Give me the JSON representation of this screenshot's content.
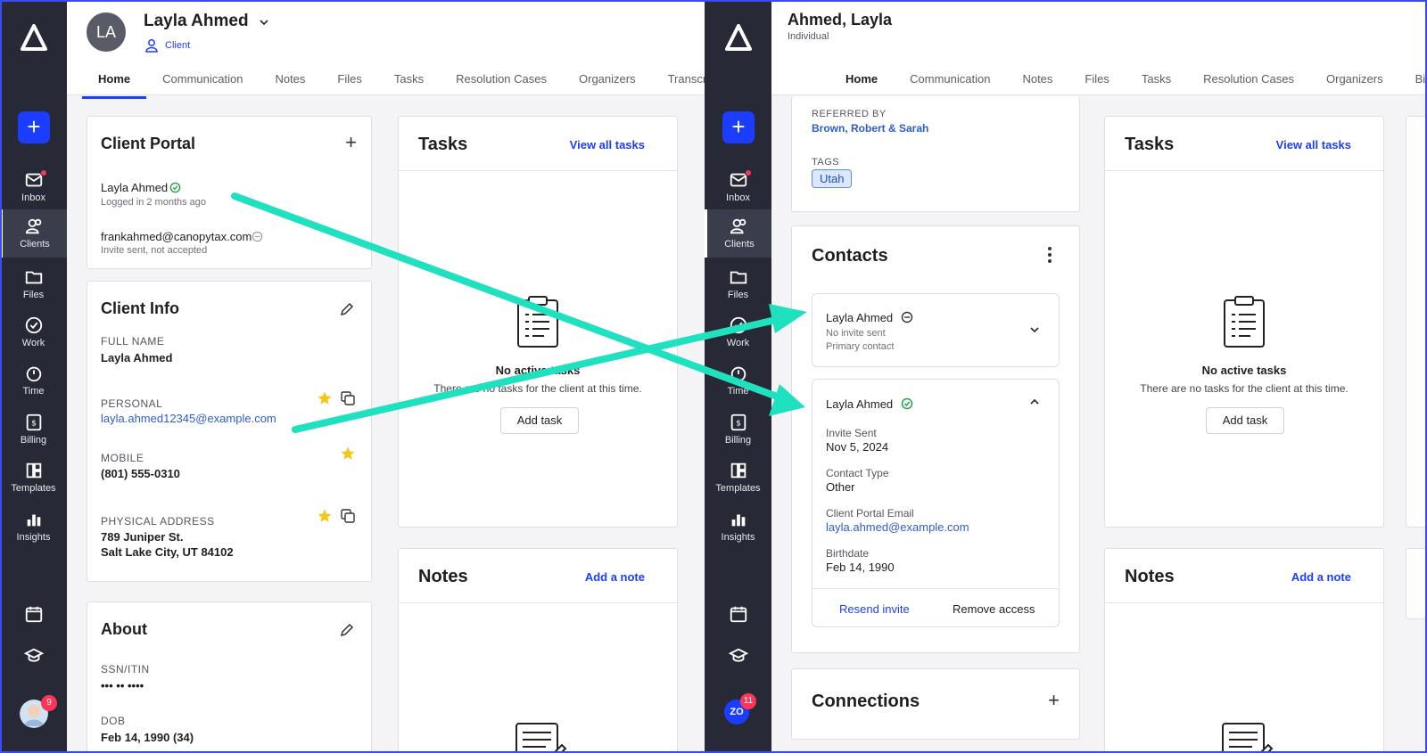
{
  "left": {
    "header": {
      "initials": "LA",
      "name": "Layla Ahmed",
      "type_label": "Client"
    },
    "tabs": [
      "Home",
      "Communication",
      "Notes",
      "Files",
      "Tasks",
      "Resolution Cases",
      "Organizers",
      "Transcr"
    ],
    "client_portal": {
      "title": "Client Portal",
      "user1_name": "Layla Ahmed",
      "user1_status": "Logged in 2 months ago",
      "user2_email": "frankahmed@canopytax.com",
      "user2_status": "Invite sent, not accepted"
    },
    "client_info": {
      "title": "Client Info",
      "full_name_label": "FULL NAME",
      "full_name": "Layla Ahmed",
      "personal_label": "PERSONAL",
      "personal_email": "layla.ahmed12345@example.com",
      "mobile_label": "MOBILE",
      "mobile": "(801) 555-0310",
      "address_label": "PHYSICAL ADDRESS",
      "address_line1": "789 Juniper St.",
      "address_line2": "Salt Lake City, UT 84102"
    },
    "about": {
      "title": "About",
      "ssn_label": "SSN/ITIN",
      "ssn_value": "••• •• ••••",
      "dob_label": "DOB",
      "dob_value": "Feb 14, 1990 (34)"
    },
    "tasks": {
      "title": "Tasks",
      "view_all": "View all tasks",
      "empty_title": "No active tasks",
      "empty_desc": "There are no tasks for the client at this time.",
      "add_button": "Add task"
    },
    "notes": {
      "title": "Notes",
      "add_link": "Add a note"
    }
  },
  "right": {
    "header": {
      "name": "Ahmed, Layla",
      "subtitle": "Individual"
    },
    "tabs": [
      "Home",
      "Communication",
      "Notes",
      "Files",
      "Tasks",
      "Resolution Cases",
      "Organizers",
      "Bi"
    ],
    "referred": {
      "label": "REFERRED BY",
      "value": "Brown, Robert & Sarah",
      "tags_label": "TAGS",
      "tag": "Utah"
    },
    "contacts": {
      "title": "Contacts",
      "c1_name": "Layla Ahmed",
      "c1_status": "No invite sent",
      "c1_role": "Primary contact",
      "c2_name": "Layla Ahmed",
      "invite_sent_label": "Invite Sent",
      "invite_sent_value": "Nov 5, 2024",
      "contact_type_label": "Contact Type",
      "contact_type_value": "Other",
      "portal_email_label": "Client Portal Email",
      "portal_email_value": "layla.ahmed@example.com",
      "birthdate_label": "Birthdate",
      "birthdate_value": "Feb 14, 1990",
      "resend": "Resend invite",
      "remove": "Remove access"
    },
    "connections": {
      "title": "Connections"
    },
    "tasks": {
      "title": "Tasks",
      "view_all": "View all tasks",
      "empty_title": "No active tasks",
      "empty_desc": "There are no tasks for the client at this time.",
      "add_button": "Add task"
    },
    "notes": {
      "title": "Notes",
      "add_link": "Add a note"
    },
    "user_initials": "ZO",
    "user_badge": "11"
  },
  "sidebar": {
    "add": "+",
    "items": [
      "Inbox",
      "Clients",
      "Files",
      "Work",
      "Time",
      "Billing",
      "Templates",
      "Insights"
    ],
    "left_badge": "9"
  },
  "colors": {
    "accent": "#1b3dff",
    "sidebar": "#272a36",
    "arrow": "#1fe0bf",
    "success": "#22a34a"
  }
}
